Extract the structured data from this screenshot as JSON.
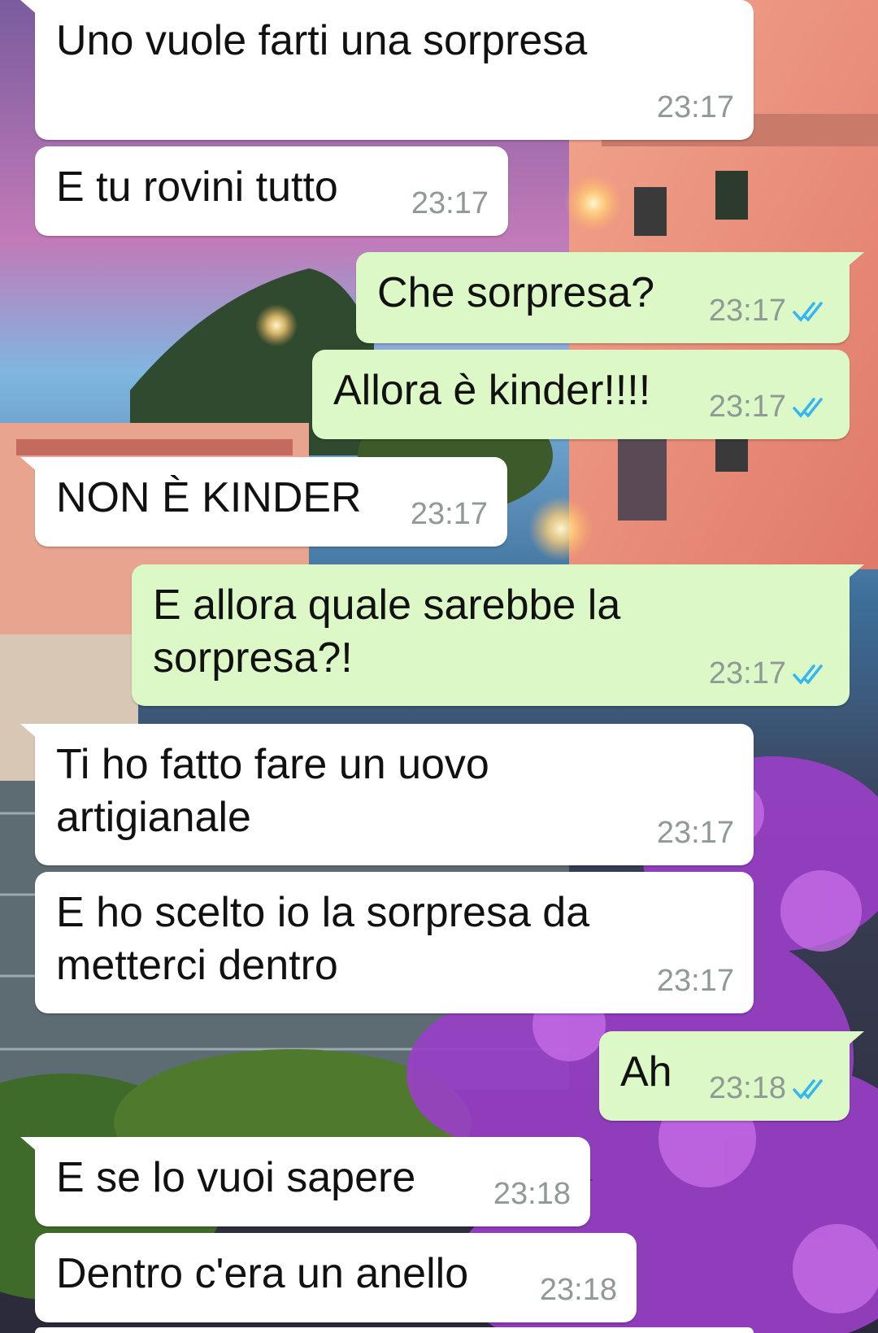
{
  "chat": {
    "messages": [
      {
        "dir": "in",
        "text": "Uno vuole farti una sorpresa",
        "time": "23:17"
      },
      {
        "dir": "in",
        "text": "E tu rovini tutto",
        "time": "23:17"
      },
      {
        "dir": "out",
        "text": "Che sorpresa?",
        "time": "23:17",
        "status": "read"
      },
      {
        "dir": "out",
        "text": "Allora è kinder!!!!",
        "time": "23:17",
        "status": "read"
      },
      {
        "dir": "in",
        "text": "NON È KINDER",
        "time": "23:17"
      },
      {
        "dir": "out",
        "text": "E allora quale sarebbe la\nsorpresa?!",
        "time": "23:17",
        "status": "read"
      },
      {
        "dir": "in",
        "text": "Ti ho fatto fare un uovo\nartigianale",
        "time": "23:17"
      },
      {
        "dir": "in",
        "text": "E ho scelto io la sorpresa da\nmetterci dentro",
        "time": "23:17"
      },
      {
        "dir": "out",
        "text": "Ah",
        "time": "23:18",
        "status": "read"
      },
      {
        "dir": "in",
        "text": "E se lo vuoi sapere",
        "time": "23:18"
      },
      {
        "dir": "in",
        "text": "Dentro c'era un anello",
        "time": "23:18"
      }
    ]
  },
  "theme": {
    "incoming_bubble": "#ffffff",
    "outgoing_bubble": "#dcf8c6",
    "read_tick_color": "#34b7f1",
    "time_color": "#8f9a94"
  },
  "icons": {
    "read_status": "double-check-icon"
  }
}
